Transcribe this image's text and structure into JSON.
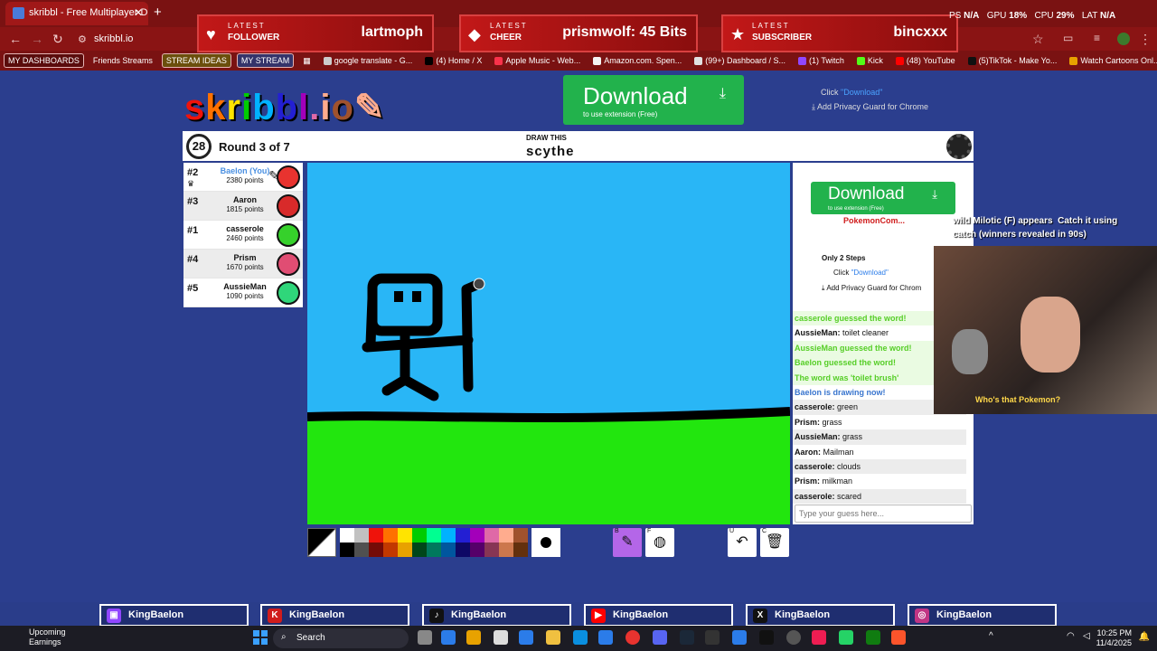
{
  "browser": {
    "tab_title": "skribbl - Free Multiplayer Draw",
    "url": "skribbl.io",
    "bookmarks": [
      "MY DASHBOARDS",
      "Friends Streams",
      "STREAM IDEAS",
      "MY STREAM",
      "google translate - G...",
      "(4) Home / X",
      "Apple Music - Web...",
      "Amazon.com. Spen...",
      "(99+) Dashboard / S...",
      "(1) Twitch",
      "Kick",
      "(48) YouTube",
      "(5)TikTok - Make Yo...",
      "Watch Cartoons Onl..."
    ]
  },
  "alerts": [
    {
      "small": "LATEST",
      "label": "FOLLOWER",
      "value": "lartmoph",
      "icon": "♥"
    },
    {
      "small": "LATEST",
      "label": "CHEER",
      "value": "prismwolf: 45 Bits",
      "icon": "◆"
    },
    {
      "small": "LATEST",
      "label": "SUBSCRIBER",
      "value": "bincxxx",
      "icon": "★"
    }
  ],
  "stats": {
    "fps_label": "PS",
    "fps": "N/A",
    "gpu_label": "GPU",
    "gpu": "18",
    "cpu_label": "CPU",
    "cpu": "29",
    "lat_label": "LAT",
    "lat": "N/A",
    "pct": "%"
  },
  "logo": "skribbl.io",
  "ads": {
    "top": {
      "big": "Download",
      "small": "to use extension (Free)"
    },
    "side": {
      "big": "Download",
      "small": "to use extension (Free)"
    },
    "click_prefix": "Click ",
    "click_link": "\"Download\"",
    "add_privacy": "Add Privacy Guard for Chrome",
    "steps": "Only 2 Steps",
    "side_add_privacy": "Add Privacy Guard for Chrom",
    "pokemon_user": "PokemonCom..."
  },
  "game": {
    "timer": "28",
    "round": "Round 3 of 7",
    "draw_this": "DRAW THIS",
    "word": "scythe"
  },
  "players": [
    {
      "rank": "#2",
      "name": "Baelon (You)",
      "points": "2380 points",
      "color": "#e8332f",
      "you": true
    },
    {
      "rank": "#3",
      "name": "Aaron",
      "points": "1815 points",
      "color": "#d82a2a",
      "you": false
    },
    {
      "rank": "#1",
      "name": "casserole",
      "points": "2460 points",
      "color": "#36d12b",
      "you": false
    },
    {
      "rank": "#4",
      "name": "Prism",
      "points": "1670 points",
      "color": "#e04d73",
      "you": false
    },
    {
      "rank": "#5",
      "name": "AussieMan",
      "points": "1090 points",
      "color": "#2fd67a",
      "you": false
    }
  ],
  "palette": [
    "#ffffff",
    "#c1c1c1",
    "#ef130b",
    "#ff7100",
    "#ffe400",
    "#00cc00",
    "#00ff91",
    "#00b2ff",
    "#231fd3",
    "#a300ba",
    "#df69a7",
    "#ffac8e",
    "#a0522d",
    "#000000",
    "#505050",
    "#740b07",
    "#c23800",
    "#e8a200",
    "#004619",
    "#00785d",
    "#00569e",
    "#0e0865",
    "#550069",
    "#873554",
    "#cc774d",
    "#63300d"
  ],
  "tool_keys": {
    "brush": "B",
    "fill": "F",
    "undo": "U",
    "clear": "C"
  },
  "chat": [
    {
      "text": "casserole guessed the word!",
      "style": "green"
    },
    {
      "user": "AussieMan:",
      "text": " toilet cleaner",
      "style": "plain"
    },
    {
      "text": "AussieMan guessed the word!",
      "style": "green"
    },
    {
      "text": "Baelon guessed the word!",
      "style": "green"
    },
    {
      "text": "The word was 'toilet brush'",
      "style": "green"
    },
    {
      "text": "Baelon is drawing now!",
      "style": "blue"
    },
    {
      "user": "casserole:",
      "text": " green",
      "style": "alt"
    },
    {
      "user": "Prism:",
      "text": " grass",
      "style": "plain"
    },
    {
      "user": "AussieMan:",
      "text": " grass",
      "style": "alt"
    },
    {
      "user": "Aaron:",
      "text": " Mailman",
      "style": "plain"
    },
    {
      "user": "casserole:",
      "text": " clouds",
      "style": "alt"
    },
    {
      "user": "Prism:",
      "text": " milkman",
      "style": "plain"
    },
    {
      "user": "casserole:",
      "text": " scared",
      "style": "alt"
    }
  ],
  "chat_placeholder": "Type your guess here...",
  "stream": {
    "pokemon_line1": "wild Milotic (F) appears",
    "pokemon_line1b": "Catch it using",
    "pokemon_line2": "catch (winners revealed in 90s)",
    "webcam_caption": "Who's that Pokemon?"
  },
  "socials": [
    {
      "name": "KingBaelon",
      "icon": "tw"
    },
    {
      "name": "KingBaelon",
      "icon": "K"
    },
    {
      "name": "KingBaelon",
      "icon": "tt"
    },
    {
      "name": "KingBaelon",
      "icon": "yt"
    },
    {
      "name": "KingBaelon",
      "icon": "X"
    },
    {
      "name": "KingBaelon",
      "icon": "ig"
    }
  ],
  "taskbar": {
    "weather_1": "Upcoming",
    "weather_2": "Earnings",
    "search": "Search",
    "time": "10:25 PM",
    "date": "11/4/2025"
  }
}
